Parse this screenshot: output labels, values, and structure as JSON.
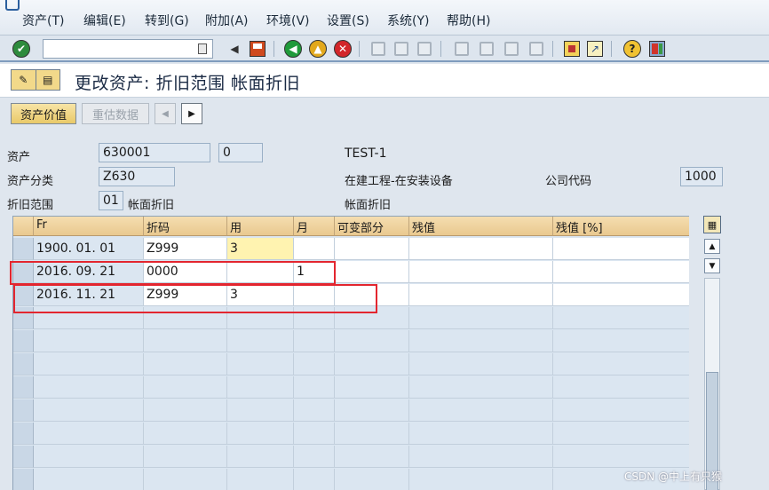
{
  "menu": [
    "资产(T)",
    "编辑(E)",
    "转到(G)",
    "附加(A)",
    "环境(V)",
    "设置(S)",
    "系统(Y)",
    "帮助(H)"
  ],
  "toolbar": {
    "command_field_value": "",
    "icons": [
      "enter-icon",
      "command-dropdown-icon",
      "back-arrow-icon",
      "save-icon",
      "back-icon",
      "exit-icon",
      "cancel-icon",
      "print-icon",
      "find-icon",
      "find-next-icon",
      "first-page-icon",
      "previous-page-icon",
      "next-page-icon",
      "last-page-icon",
      "create-session-icon",
      "shortcut-icon",
      "help-icon",
      "layout-icon"
    ]
  },
  "title": "更改资产: 折旧范围 帐面折旧",
  "app_toolbar": {
    "asset_value_label": "资产价值",
    "revalue_label": "重估数据",
    "prev_icon": "◀",
    "next_icon": "▶"
  },
  "header": {
    "asset_label": "资产",
    "asset_number": "630001",
    "asset_sub": "0",
    "asset_desc": "TEST-1",
    "asset_class_label": "资产分类",
    "asset_class": "Z630",
    "asset_class_desc": "在建工程-在安装设备",
    "company_code_label": "公司代码",
    "company_code": "1000",
    "depr_area_label": "折旧范围",
    "depr_area": "01",
    "depr_area_name": "帐面折旧",
    "depr_area_desc": "帐面折旧"
  },
  "table": {
    "columns": [
      "Fr",
      "折码",
      "用",
      "月",
      "可变部分",
      "残值",
      "残值 [%]"
    ],
    "rows": [
      [
        "1900. 01. 01",
        "Z999",
        "3",
        "",
        "",
        "",
        ""
      ],
      [
        "2016. 09. 21",
        "0000",
        "",
        "1",
        "",
        "",
        ""
      ],
      [
        "2016. 11. 21",
        "Z999",
        "3",
        "",
        "",
        "",
        ""
      ]
    ],
    "empty_rows": 8
  },
  "watermark": "CSDN @中上有只猴",
  "colors": {
    "accent_button": "#e9c968",
    "annotation_red": "#e3262f",
    "toolbar_border": "#7f9bbd"
  }
}
